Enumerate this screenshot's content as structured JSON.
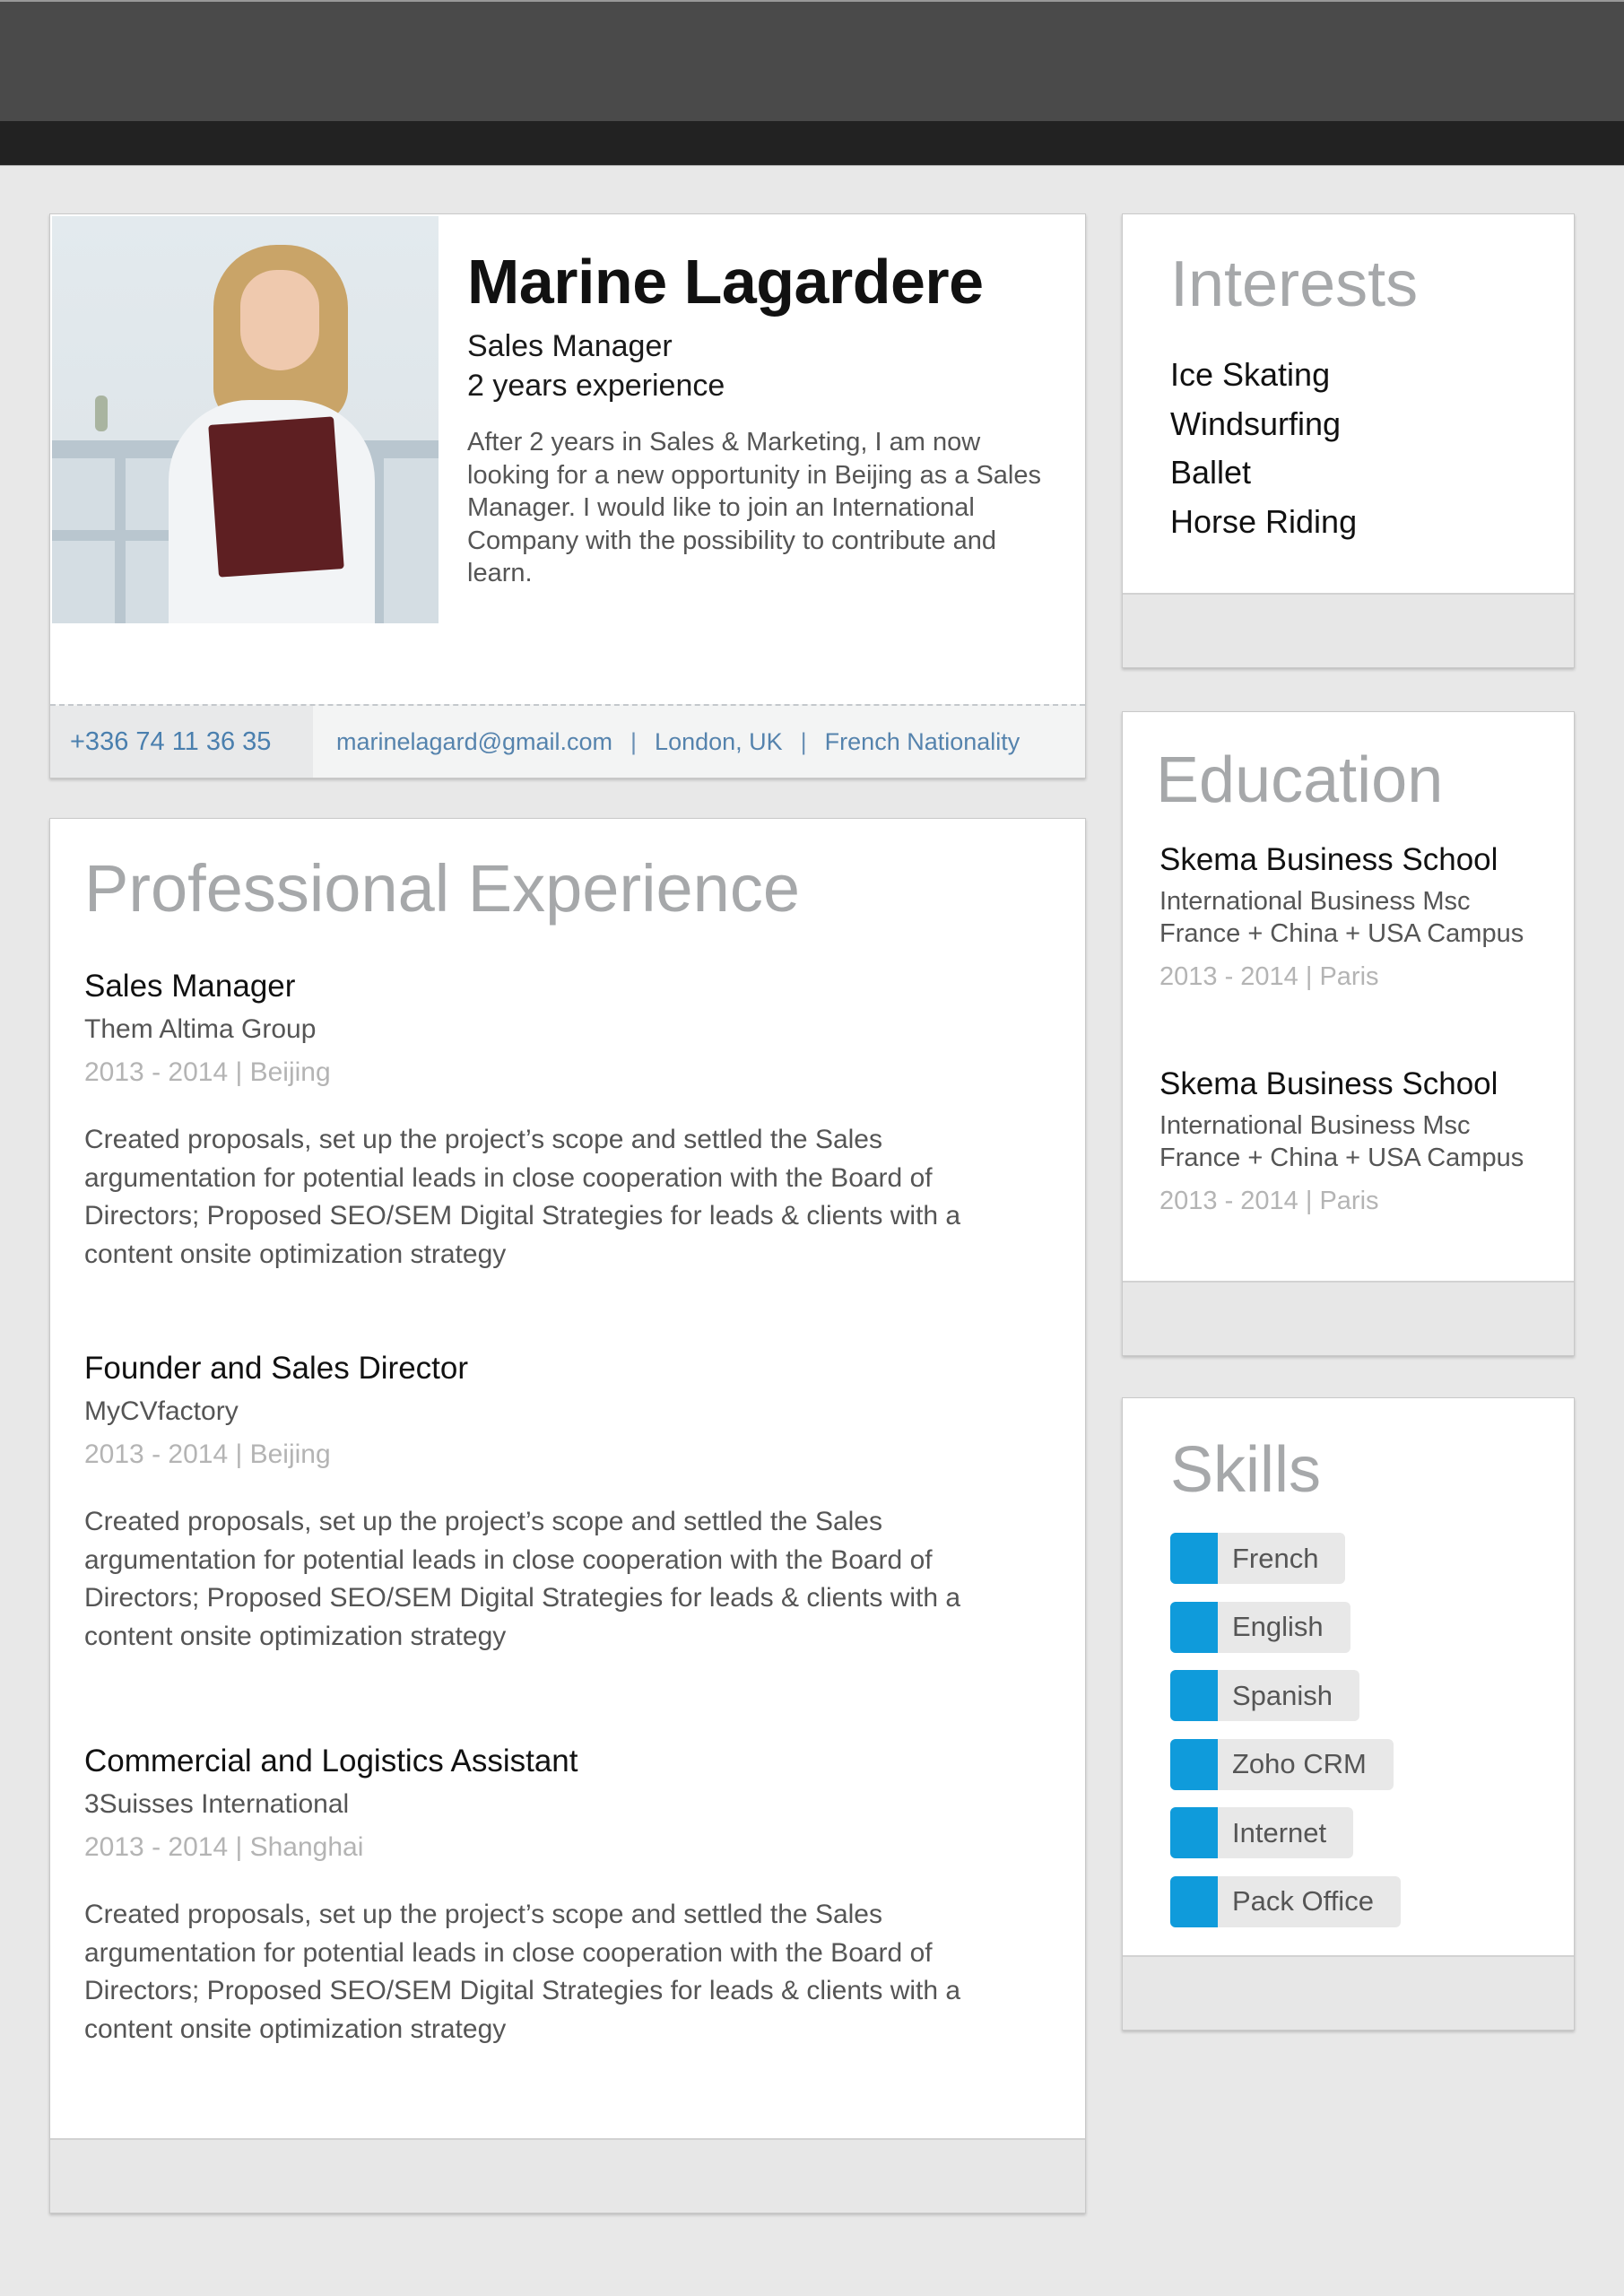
{
  "profile": {
    "name": "Marine Lagardere",
    "title": "Sales Manager",
    "experience": "2 years experience",
    "summary": "After 2 years in Sales & Marketing, I am now looking for a new opportunity in Beijing as a Sales Manager. I would like to join an International Company with the possibility to contribute and learn.",
    "photo_alt": "profile-photo",
    "contact": {
      "phone": "+336 74 11 36 35",
      "email": "marinelagard@gmail.com",
      "separator": "|",
      "location": "London, UK",
      "nationality": "French Nationality"
    }
  },
  "experience": {
    "heading": "Professional Experience",
    "jobs": [
      {
        "title": "Sales Manager",
        "company": "Them Altima Group",
        "dates": "2013 - 2014 | Beijing",
        "description": "Created proposals, set up the project’s scope and settled the Sales argumentation for potential leads in close cooperation with the Board of Directors; Proposed SEO/SEM Digital Strategies for leads & clients with a content onsite optimization strategy"
      },
      {
        "title": "Founder and Sales Director",
        "company": "MyCVfactory",
        "dates": "2013 - 2014 | Beijing",
        "description": "Created proposals, set up the project’s scope and settled the Sales argumentation for potential leads in close cooperation with the Board of Directors; Proposed SEO/SEM Digital Strategies for leads & clients with a content onsite optimization strategy"
      },
      {
        "title": "Commercial and Logistics Assistant",
        "company": "3Suisses International",
        "dates": "2013 - 2014 | Shanghai",
        "description": "Created proposals, set up the project’s scope and settled the Sales argumentation for potential leads in close cooperation with the Board of Directors; Proposed SEO/SEM Digital Strategies for leads & clients with a content onsite optimization strategy"
      }
    ]
  },
  "interests": {
    "heading": "Interests",
    "items": [
      "Ice Skating",
      "Windsurfing",
      "Ballet",
      "Horse Riding"
    ]
  },
  "education": {
    "heading": "Education",
    "items": [
      {
        "school": "Skema Business School",
        "degree_line1": "International Business Msc",
        "degree_line2": "France + China + USA Campus",
        "dates": "2013 - 2014 | Paris"
      },
      {
        "school": "Skema Business School",
        "degree_line1": "International Business Msc",
        "degree_line2": "France + China + USA Campus",
        "dates": "2013 - 2014 | Paris"
      }
    ]
  },
  "skills": {
    "heading": "Skills",
    "accent_color": "#0f9bdb",
    "items": [
      "French",
      "English",
      "Spanish",
      "Zoho CRM",
      "Internet",
      "Pack Office"
    ]
  }
}
